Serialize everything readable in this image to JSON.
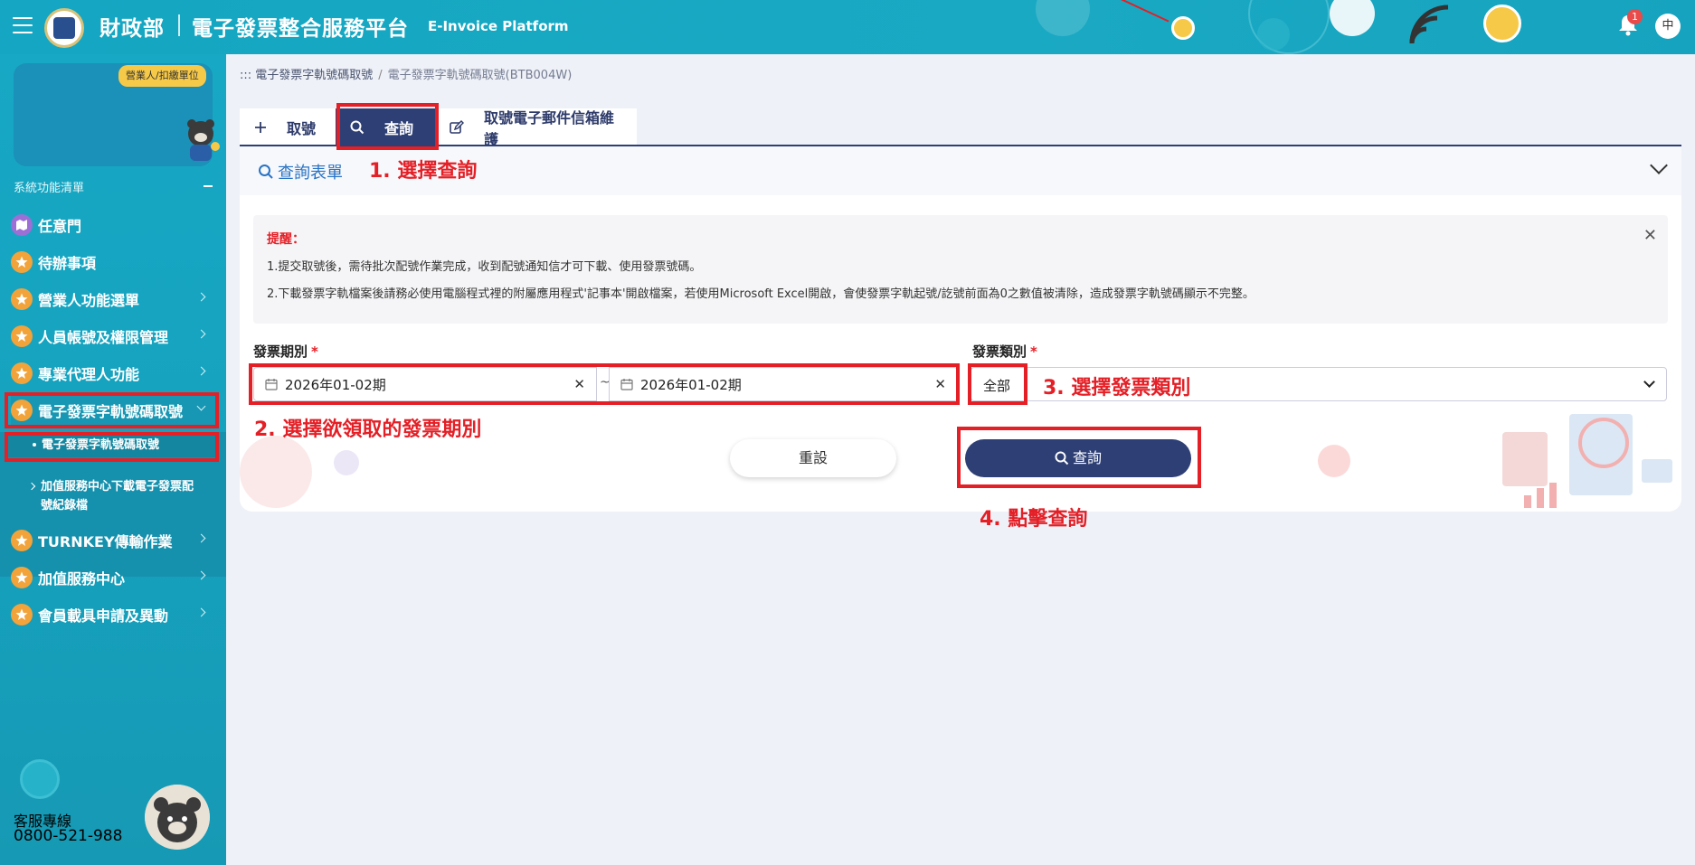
{
  "header": {
    "ministry": "財政部",
    "title": "電子發票整合服務平台",
    "subtitle_en": "E-Invoice Platform",
    "notification_count": "1",
    "language": "中"
  },
  "sidebar": {
    "role_badge": "營業人/扣繳單位",
    "menu_heading": "系統功能清單",
    "items": [
      {
        "label": "任意門",
        "icon": "map-icon"
      },
      {
        "label": "待辦事項",
        "icon": "star-icon"
      },
      {
        "label": "營業人功能選單",
        "icon": "star-icon"
      },
      {
        "label": "人員帳號及權限管理",
        "icon": "star-icon"
      },
      {
        "label": "專業代理人功能",
        "icon": "star-icon"
      },
      {
        "label": "電子發票字軌號碼取號",
        "icon": "star-icon"
      },
      {
        "label": "TURNKEY傳輸作業",
        "icon": "star-icon"
      },
      {
        "label": "加值服務中心",
        "icon": "star-icon"
      },
      {
        "label": "會員載具申請及異動",
        "icon": "star-icon"
      }
    ],
    "sub_items": [
      {
        "label": "電子發票字軌號碼取號"
      },
      {
        "label_line1": "加值服務中心下載電子發票配",
        "label_line2": "號紀錄檔"
      }
    ],
    "hotline_label": "客服專線",
    "hotline_number": "0800-521-988"
  },
  "breadcrumb": {
    "root": "::: 電子發票字軌號碼取號",
    "current": "電子發票字軌號碼取號(BTB004W)"
  },
  "tabs": [
    {
      "label": "取號",
      "icon": "plus-icon"
    },
    {
      "label": "查詢",
      "icon": "search-icon",
      "active": true
    },
    {
      "label": "取號電子郵件信箱維護",
      "icon": "edit-icon"
    }
  ],
  "panel": {
    "title": "查詢表單"
  },
  "notice": {
    "title": "提醒：",
    "line1": "1.提交取號後，需待批次配號作業完成，收到配號通知信才可下載、使用發票號碼。",
    "line2": "2.下載發票字軌檔案後請務必使用電腦程式裡的附屬應用程式'記事本'開啟檔案，若使用Microsoft Excel開啟，會使發票字軌起號/訖號前面為0之數值被清除，造成發票字軌號碼顯示不完整。"
  },
  "form": {
    "period_label": "發票期別",
    "period_start": "2026年01-02期",
    "period_end": "2026年01-02期",
    "type_label": "發票類別",
    "type_value": "全部",
    "reset_label": "重設",
    "search_label": "查詢"
  },
  "annotations": {
    "step1": "1. 選擇查詢",
    "step2": "2. 選擇欲領取的發票期別",
    "step3": "3. 選擇發票類別",
    "step4": "4. 點擊查詢"
  },
  "colors": {
    "header_bg": "#14a6c2",
    "sidebar_bg": "#17a8c5",
    "primary": "#2e3f75",
    "annotation_red": "#e41f26",
    "menu_icon": "#f2a33a"
  }
}
